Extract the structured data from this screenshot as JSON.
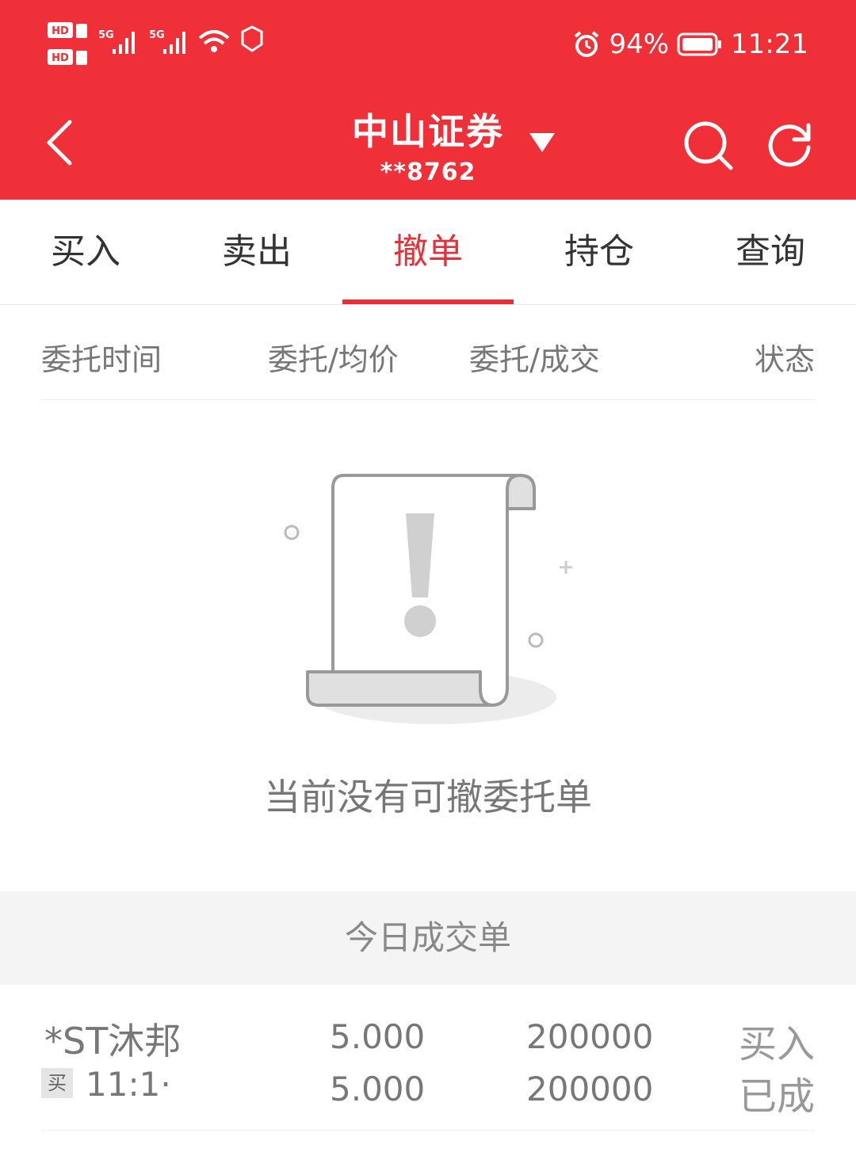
{
  "status_bar": {
    "sim1": "HD 1",
    "sim2": "HD 2",
    "network1": "5G",
    "network2": "5G",
    "battery": "94%",
    "time": "11:21",
    "icons": [
      "hd-icon",
      "signal-icon",
      "wifi-icon",
      "hand-icon",
      "alarm-icon",
      "battery-icon"
    ]
  },
  "header": {
    "title": "中山证券",
    "account": "**8762",
    "icons": [
      "back-icon",
      "dropdown-icon",
      "search-icon",
      "refresh-icon"
    ]
  },
  "tabs": [
    {
      "label": "买入"
    },
    {
      "label": "卖出"
    },
    {
      "label": "撤单",
      "active": true
    },
    {
      "label": "持仓"
    },
    {
      "label": "查询"
    }
  ],
  "columns": [
    "委托时间",
    "委托/均价",
    "委托/成交",
    "状态"
  ],
  "empty_state": {
    "message": "当前没有可撤委托单",
    "icon": "empty-document-icon"
  },
  "today_section": {
    "title": "今日成交单"
  },
  "trades": [
    {
      "name": "*ST沐邦",
      "side_badge": "买",
      "time": "11:1·",
      "price_order": "5.000",
      "price_avg": "5.000",
      "qty_order": "200000",
      "qty_filled": "200000",
      "type": "买入",
      "status": "已成"
    }
  ],
  "colors": {
    "brand_red": "#ef3038",
    "active_tab": "#e5303a"
  }
}
